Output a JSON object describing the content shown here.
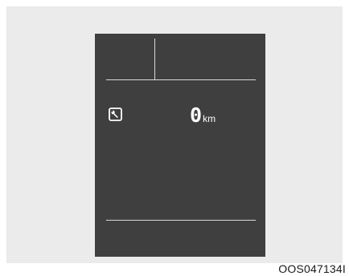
{
  "display": {
    "icon": "wrench-service-icon",
    "odometer_value": "0",
    "odometer_unit": "km"
  },
  "figure_code": "OOS047134I",
  "colors": {
    "panel_background": "#ebebeb",
    "display_background": "#3f3f3f",
    "segment_color": "#ffffff",
    "line_color": "#d8d8d8"
  }
}
